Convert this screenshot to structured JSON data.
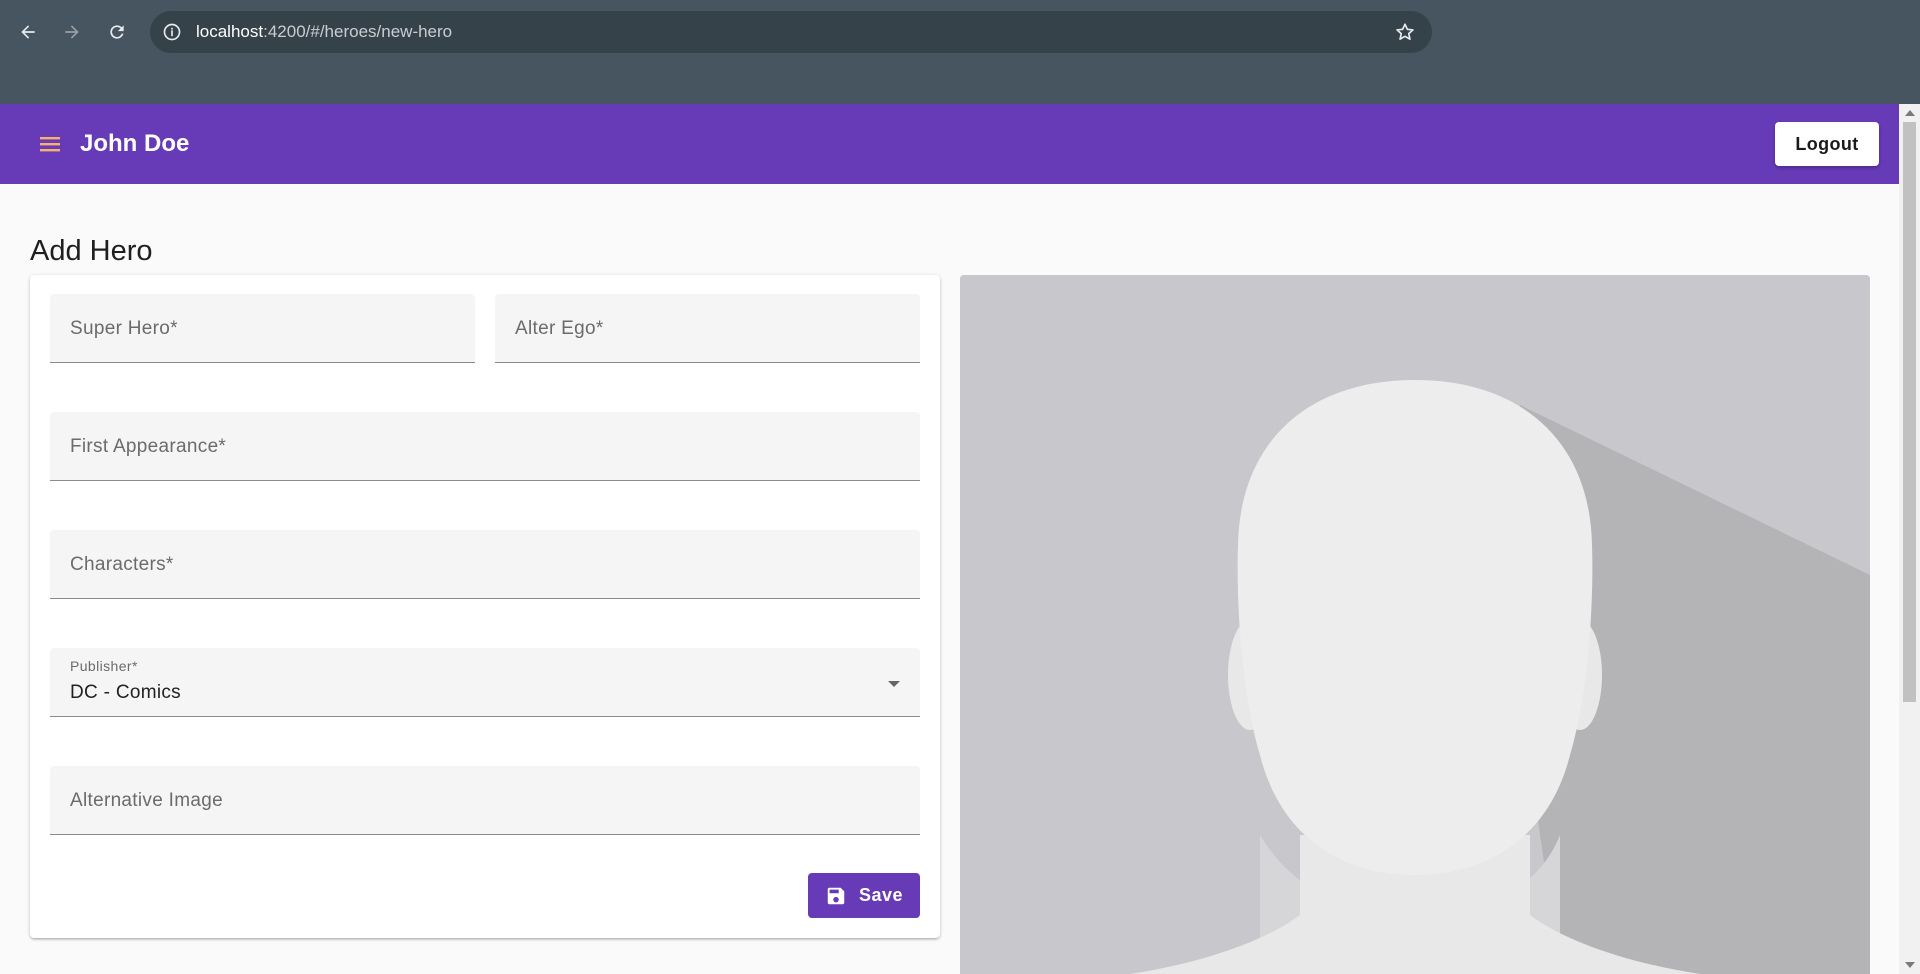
{
  "browser": {
    "url_host": "localhost",
    "url_path": ":4200/#/heroes/new-hero",
    "icons": [
      "back-arrow-icon",
      "forward-arrow-icon",
      "reload-icon",
      "info-icon",
      "star-icon"
    ]
  },
  "toolbar": {
    "user_name": "John Doe",
    "logout_label": "Logout",
    "menu_icon": "hamburger-menu-icon",
    "accent_color": "#673ab7"
  },
  "page": {
    "title": "Add Hero"
  },
  "form": {
    "super_hero_placeholder": "Super Hero*",
    "alter_ego_placeholder": "Alter Ego*",
    "first_appearance_placeholder": "First Appearance*",
    "characters_placeholder": "Characters*",
    "publisher": {
      "label": "Publisher*",
      "value": "DC - Comics"
    },
    "alt_image_placeholder": "Alternative Image",
    "save_label": "Save",
    "save_icon": "floppy-disk-icon"
  },
  "image": {
    "icon": "placeholder-avatar-image"
  }
}
